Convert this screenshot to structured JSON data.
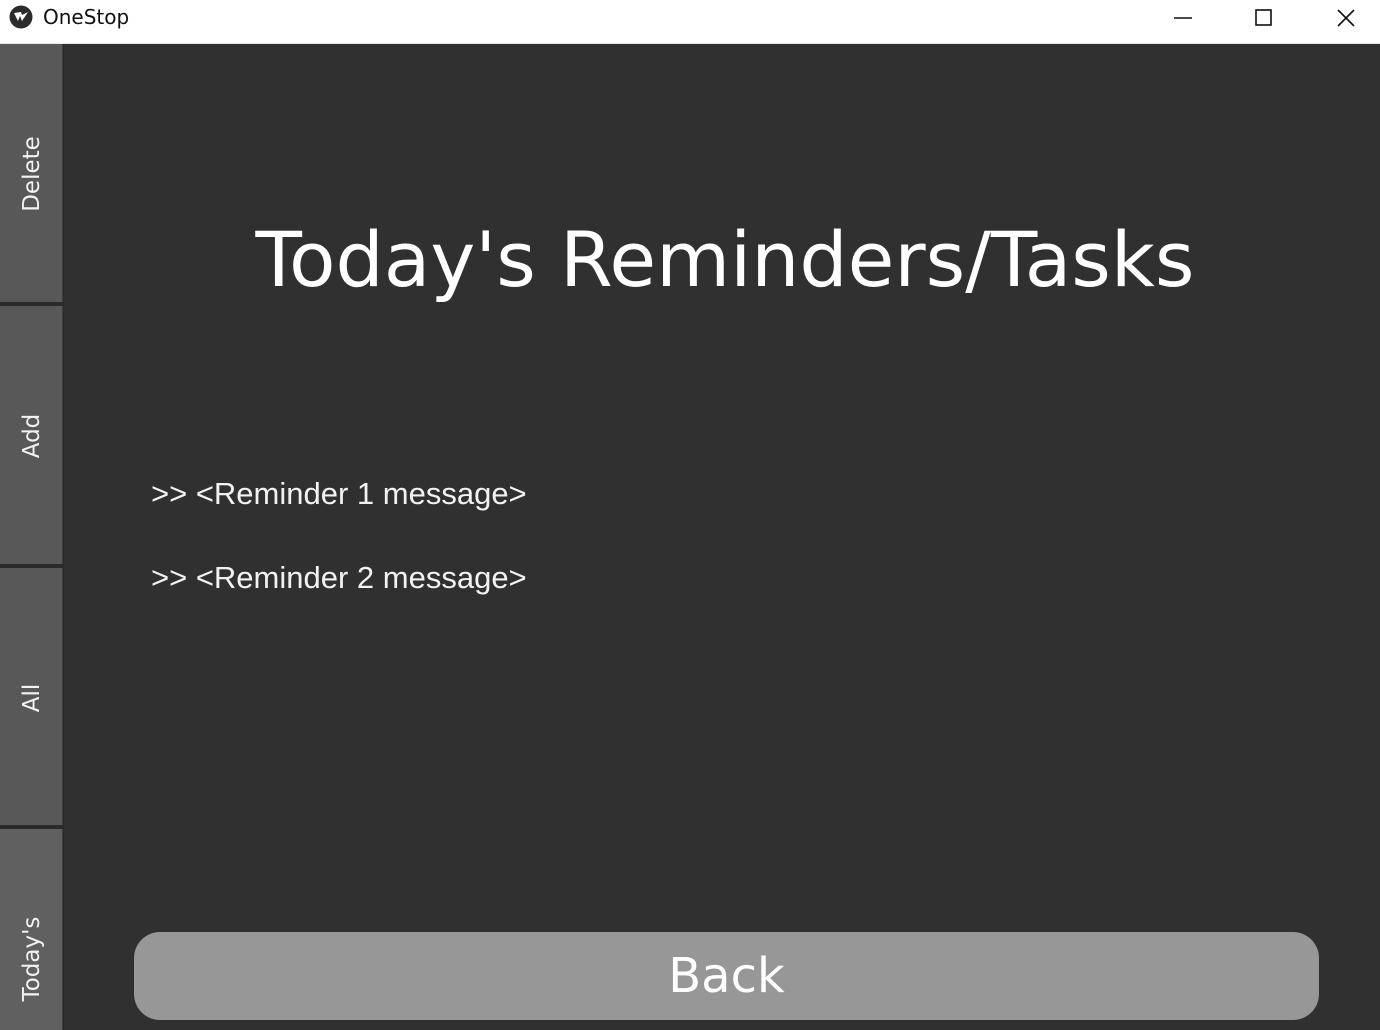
{
  "window": {
    "title": "OneStop",
    "icon": "kivy-logo-icon",
    "controls": {
      "minimize_icon": "minimize-icon",
      "maximize_icon": "maximize-icon",
      "close_icon": "close-icon"
    }
  },
  "tabs": [
    {
      "label": "Delete"
    },
    {
      "label": "Add"
    },
    {
      "label": "All"
    },
    {
      "label": "Today's",
      "active": true
    }
  ],
  "main": {
    "title": "Today's Reminders/Tasks",
    "reminders": [
      ">> <Reminder 1 message>",
      ">> <Reminder 2 message>"
    ],
    "back_label": "Back"
  },
  "colors": {
    "background": "#303030",
    "tab": "#585858",
    "button": "#979797",
    "text": "#ffffff"
  }
}
